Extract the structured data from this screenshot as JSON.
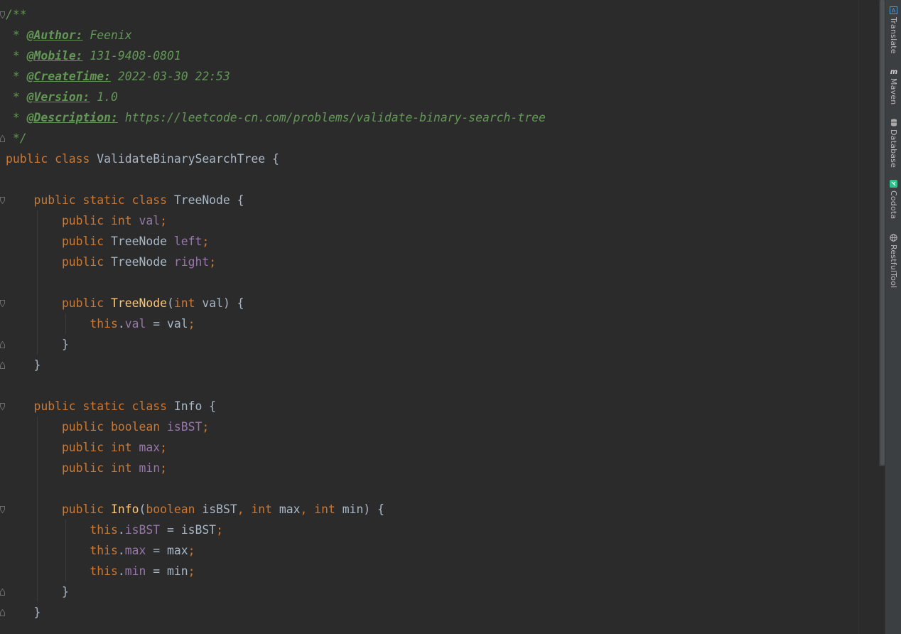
{
  "editor": {
    "lines": [
      [
        {
          "t": "/**",
          "c": "cmt"
        }
      ],
      [
        {
          "t": " * ",
          "c": "cmt"
        },
        {
          "t": "@Author:",
          "c": "tag"
        },
        {
          "t": " Feenix",
          "c": "cmt"
        }
      ],
      [
        {
          "t": " * ",
          "c": "cmt"
        },
        {
          "t": "@Mobile:",
          "c": "tag"
        },
        {
          "t": " 131-9408-0801",
          "c": "cmt"
        }
      ],
      [
        {
          "t": " * ",
          "c": "cmt"
        },
        {
          "t": "@CreateTime:",
          "c": "tag"
        },
        {
          "t": " 2022-03-30 22:53",
          "c": "cmt"
        }
      ],
      [
        {
          "t": " * ",
          "c": "cmt"
        },
        {
          "t": "@Version:",
          "c": "tag"
        },
        {
          "t": " 1.0",
          "c": "cmt"
        }
      ],
      [
        {
          "t": " * ",
          "c": "cmt"
        },
        {
          "t": "@Description:",
          "c": "tag"
        },
        {
          "t": " https://leetcode-cn.com/problems/validate-binary-search-tree",
          "c": "cmt"
        }
      ],
      [
        {
          "t": " */",
          "c": "cmt"
        }
      ],
      [
        {
          "t": "public class ",
          "c": "kw"
        },
        {
          "t": "ValidateBinarySearchTree {",
          "c": "txt"
        }
      ],
      [],
      [
        {
          "t": "    public static class ",
          "c": "kw"
        },
        {
          "t": "TreeNode {",
          "c": "txt"
        }
      ],
      [
        {
          "t": "        public int ",
          "c": "kw"
        },
        {
          "t": "val",
          "c": "fld"
        },
        {
          "t": ";",
          "c": "kw"
        }
      ],
      [
        {
          "t": "        public ",
          "c": "kw"
        },
        {
          "t": "TreeNode ",
          "c": "txt"
        },
        {
          "t": "left",
          "c": "fld"
        },
        {
          "t": ";",
          "c": "kw"
        }
      ],
      [
        {
          "t": "        public ",
          "c": "kw"
        },
        {
          "t": "TreeNode ",
          "c": "txt"
        },
        {
          "t": "right",
          "c": "fld"
        },
        {
          "t": ";",
          "c": "kw"
        }
      ],
      [],
      [
        {
          "t": "        public ",
          "c": "kw"
        },
        {
          "t": "TreeNode",
          "c": "fn"
        },
        {
          "t": "(",
          "c": "txt"
        },
        {
          "t": "int ",
          "c": "kw"
        },
        {
          "t": "val) {",
          "c": "txt"
        }
      ],
      [
        {
          "t": "            this",
          "c": "kw"
        },
        {
          "t": ".",
          "c": "txt"
        },
        {
          "t": "val",
          "c": "fld"
        },
        {
          "t": " = val",
          "c": "txt"
        },
        {
          "t": ";",
          "c": "kw"
        }
      ],
      [
        {
          "t": "        }",
          "c": "txt"
        }
      ],
      [
        {
          "t": "    }",
          "c": "txt"
        }
      ],
      [],
      [
        {
          "t": "    public static class ",
          "c": "kw"
        },
        {
          "t": "Info {",
          "c": "txt"
        }
      ],
      [
        {
          "t": "        public boolean ",
          "c": "kw"
        },
        {
          "t": "isBST",
          "c": "fld"
        },
        {
          "t": ";",
          "c": "kw"
        }
      ],
      [
        {
          "t": "        public int ",
          "c": "kw"
        },
        {
          "t": "max",
          "c": "fld"
        },
        {
          "t": ";",
          "c": "kw"
        }
      ],
      [
        {
          "t": "        public int ",
          "c": "kw"
        },
        {
          "t": "min",
          "c": "fld"
        },
        {
          "t": ";",
          "c": "kw"
        }
      ],
      [],
      [
        {
          "t": "        public ",
          "c": "kw"
        },
        {
          "t": "Info",
          "c": "fn"
        },
        {
          "t": "(",
          "c": "txt"
        },
        {
          "t": "boolean ",
          "c": "kw"
        },
        {
          "t": "isBST",
          "c": "txt"
        },
        {
          "t": ", ",
          "c": "kw"
        },
        {
          "t": "int ",
          "c": "kw"
        },
        {
          "t": "max",
          "c": "txt"
        },
        {
          "t": ", ",
          "c": "kw"
        },
        {
          "t": "int ",
          "c": "kw"
        },
        {
          "t": "min) {",
          "c": "txt"
        }
      ],
      [
        {
          "t": "            this",
          "c": "kw"
        },
        {
          "t": ".",
          "c": "txt"
        },
        {
          "t": "isBST",
          "c": "fld"
        },
        {
          "t": " = isBST",
          "c": "txt"
        },
        {
          "t": ";",
          "c": "kw"
        }
      ],
      [
        {
          "t": "            this",
          "c": "kw"
        },
        {
          "t": ".",
          "c": "txt"
        },
        {
          "t": "max",
          "c": "fld"
        },
        {
          "t": " = max",
          "c": "txt"
        },
        {
          "t": ";",
          "c": "kw"
        }
      ],
      [
        {
          "t": "            this",
          "c": "kw"
        },
        {
          "t": ".",
          "c": "txt"
        },
        {
          "t": "min",
          "c": "fld"
        },
        {
          "t": " = min",
          "c": "txt"
        },
        {
          "t": ";",
          "c": "kw"
        }
      ],
      [
        {
          "t": "        }",
          "c": "txt"
        }
      ],
      [
        {
          "t": "    }",
          "c": "txt"
        }
      ]
    ]
  },
  "toolwindows": [
    {
      "label": "Translate",
      "icon": "translate-icon"
    },
    {
      "label": "Maven",
      "icon": "maven-icon"
    },
    {
      "label": "Database",
      "icon": "database-icon"
    },
    {
      "label": "Codota",
      "icon": "codota-icon"
    },
    {
      "label": "RestfulTool",
      "icon": "globe-icon"
    }
  ],
  "colors": {
    "background": "#2b2b2b",
    "keyword": "#cc7832",
    "field": "#9876aa",
    "method": "#ffc66d",
    "comment": "#629755",
    "text": "#a9b7c6"
  }
}
